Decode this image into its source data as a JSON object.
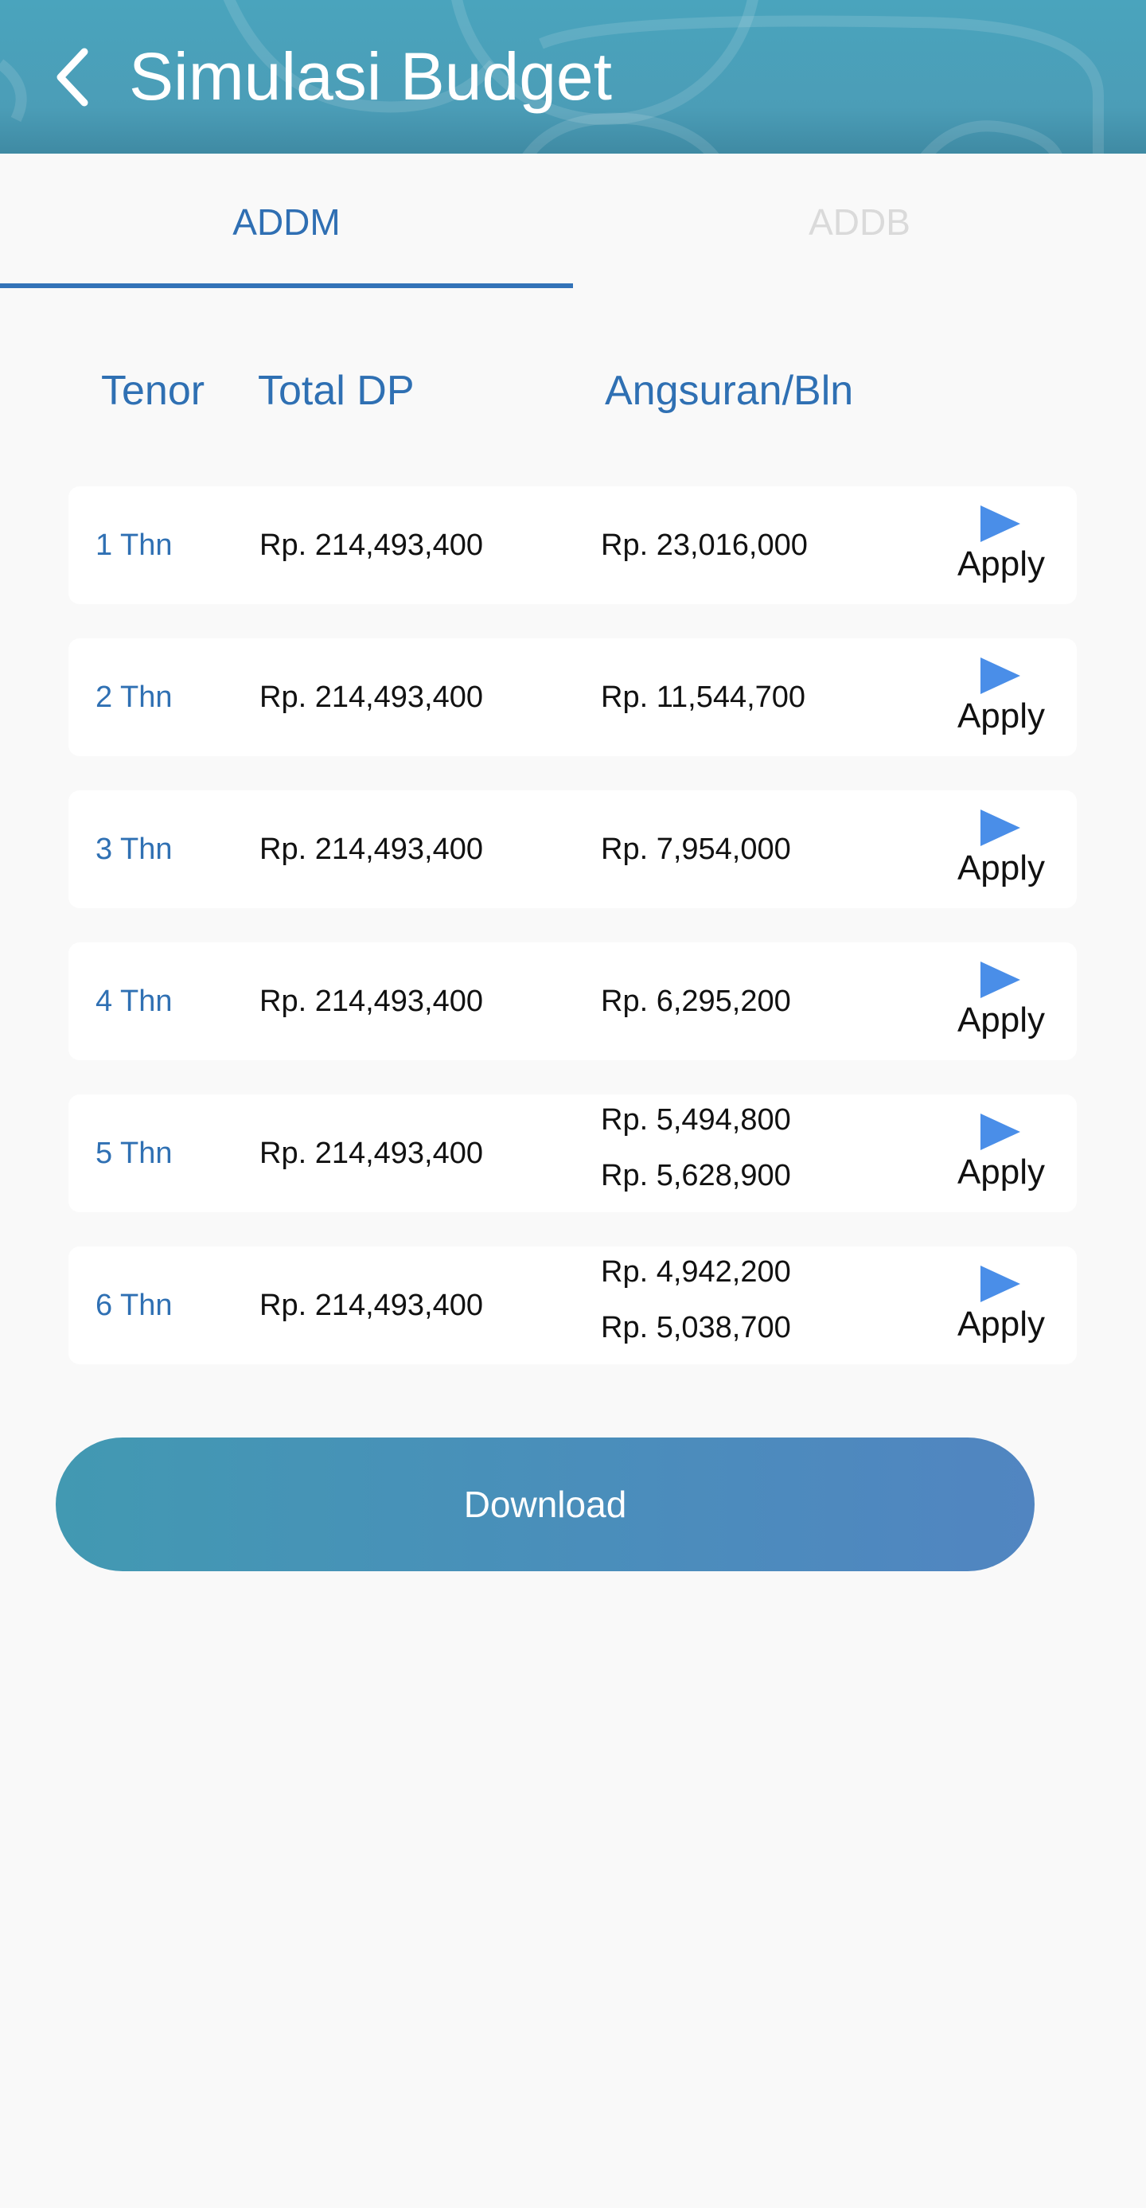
{
  "header": {
    "title": "Simulasi Budget",
    "back_icon": "chevron-left-icon"
  },
  "tabs": [
    {
      "label": "ADDM",
      "active": true
    },
    {
      "label": "ADDB",
      "active": false
    }
  ],
  "table": {
    "headers": {
      "tenor": "Tenor",
      "total_dp": "Total DP",
      "angsuran": "Angsuran/Bln"
    },
    "rows": [
      {
        "tenor": "1 Thn",
        "total_dp": "Rp. 214,493,400",
        "angsuran": [
          "Rp. 23,016,000"
        ],
        "action": "Apply"
      },
      {
        "tenor": "2 Thn",
        "total_dp": "Rp. 214,493,400",
        "angsuran": [
          "Rp. 11,544,700"
        ],
        "action": "Apply"
      },
      {
        "tenor": "3 Thn",
        "total_dp": "Rp. 214,493,400",
        "angsuran": [
          "Rp. 7,954,000"
        ],
        "action": "Apply"
      },
      {
        "tenor": "4 Thn",
        "total_dp": "Rp. 214,493,400",
        "angsuran": [
          "Rp. 6,295,200"
        ],
        "action": "Apply"
      },
      {
        "tenor": "5 Thn",
        "total_dp": "Rp. 214,493,400",
        "angsuran": [
          "Rp. 5,494,800",
          "Rp. 5,628,900"
        ],
        "action": "Apply"
      },
      {
        "tenor": "6 Thn",
        "total_dp": "Rp. 214,493,400",
        "angsuran": [
          "Rp. 4,942,200",
          "Rp. 5,038,700"
        ],
        "action": "Apply"
      }
    ]
  },
  "download_label": "Download",
  "colors": {
    "accent": "#2f70b3",
    "header_bg": "#4aa4bd",
    "play_icon": "#4a8ee8"
  }
}
